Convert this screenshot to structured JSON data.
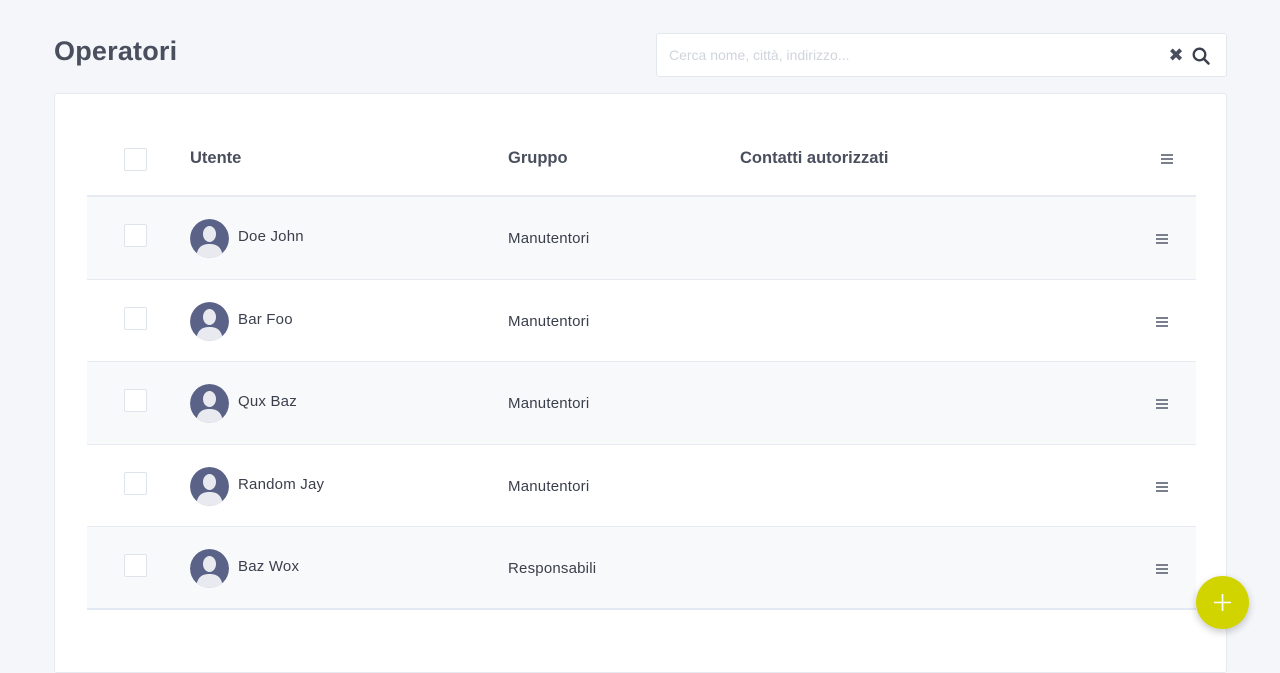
{
  "page": {
    "title": "Operatori"
  },
  "search": {
    "placeholder": "Cerca nome, città, indirizzo...",
    "value": ""
  },
  "table": {
    "columns": {
      "user": "Utente",
      "group": "Gruppo",
      "contacts": "Contatti autorizzati"
    },
    "rows": [
      {
        "name": "Doe John",
        "group": "Manutentori",
        "contacts": ""
      },
      {
        "name": "Bar Foo",
        "group": "Manutentori",
        "contacts": ""
      },
      {
        "name": "Qux Baz",
        "group": "Manutentori",
        "contacts": ""
      },
      {
        "name": "Random Jay",
        "group": "Manutentori",
        "contacts": ""
      },
      {
        "name": "Baz Wox",
        "group": "Responsabili",
        "contacts": ""
      }
    ]
  },
  "colors": {
    "accent": "#d2d400",
    "avatar": "#5a6387",
    "background": "#f4f6fa"
  },
  "icons": {
    "clear": "close-icon",
    "search": "search-icon",
    "row_menu": "menu-icon",
    "add": "plus-icon"
  }
}
